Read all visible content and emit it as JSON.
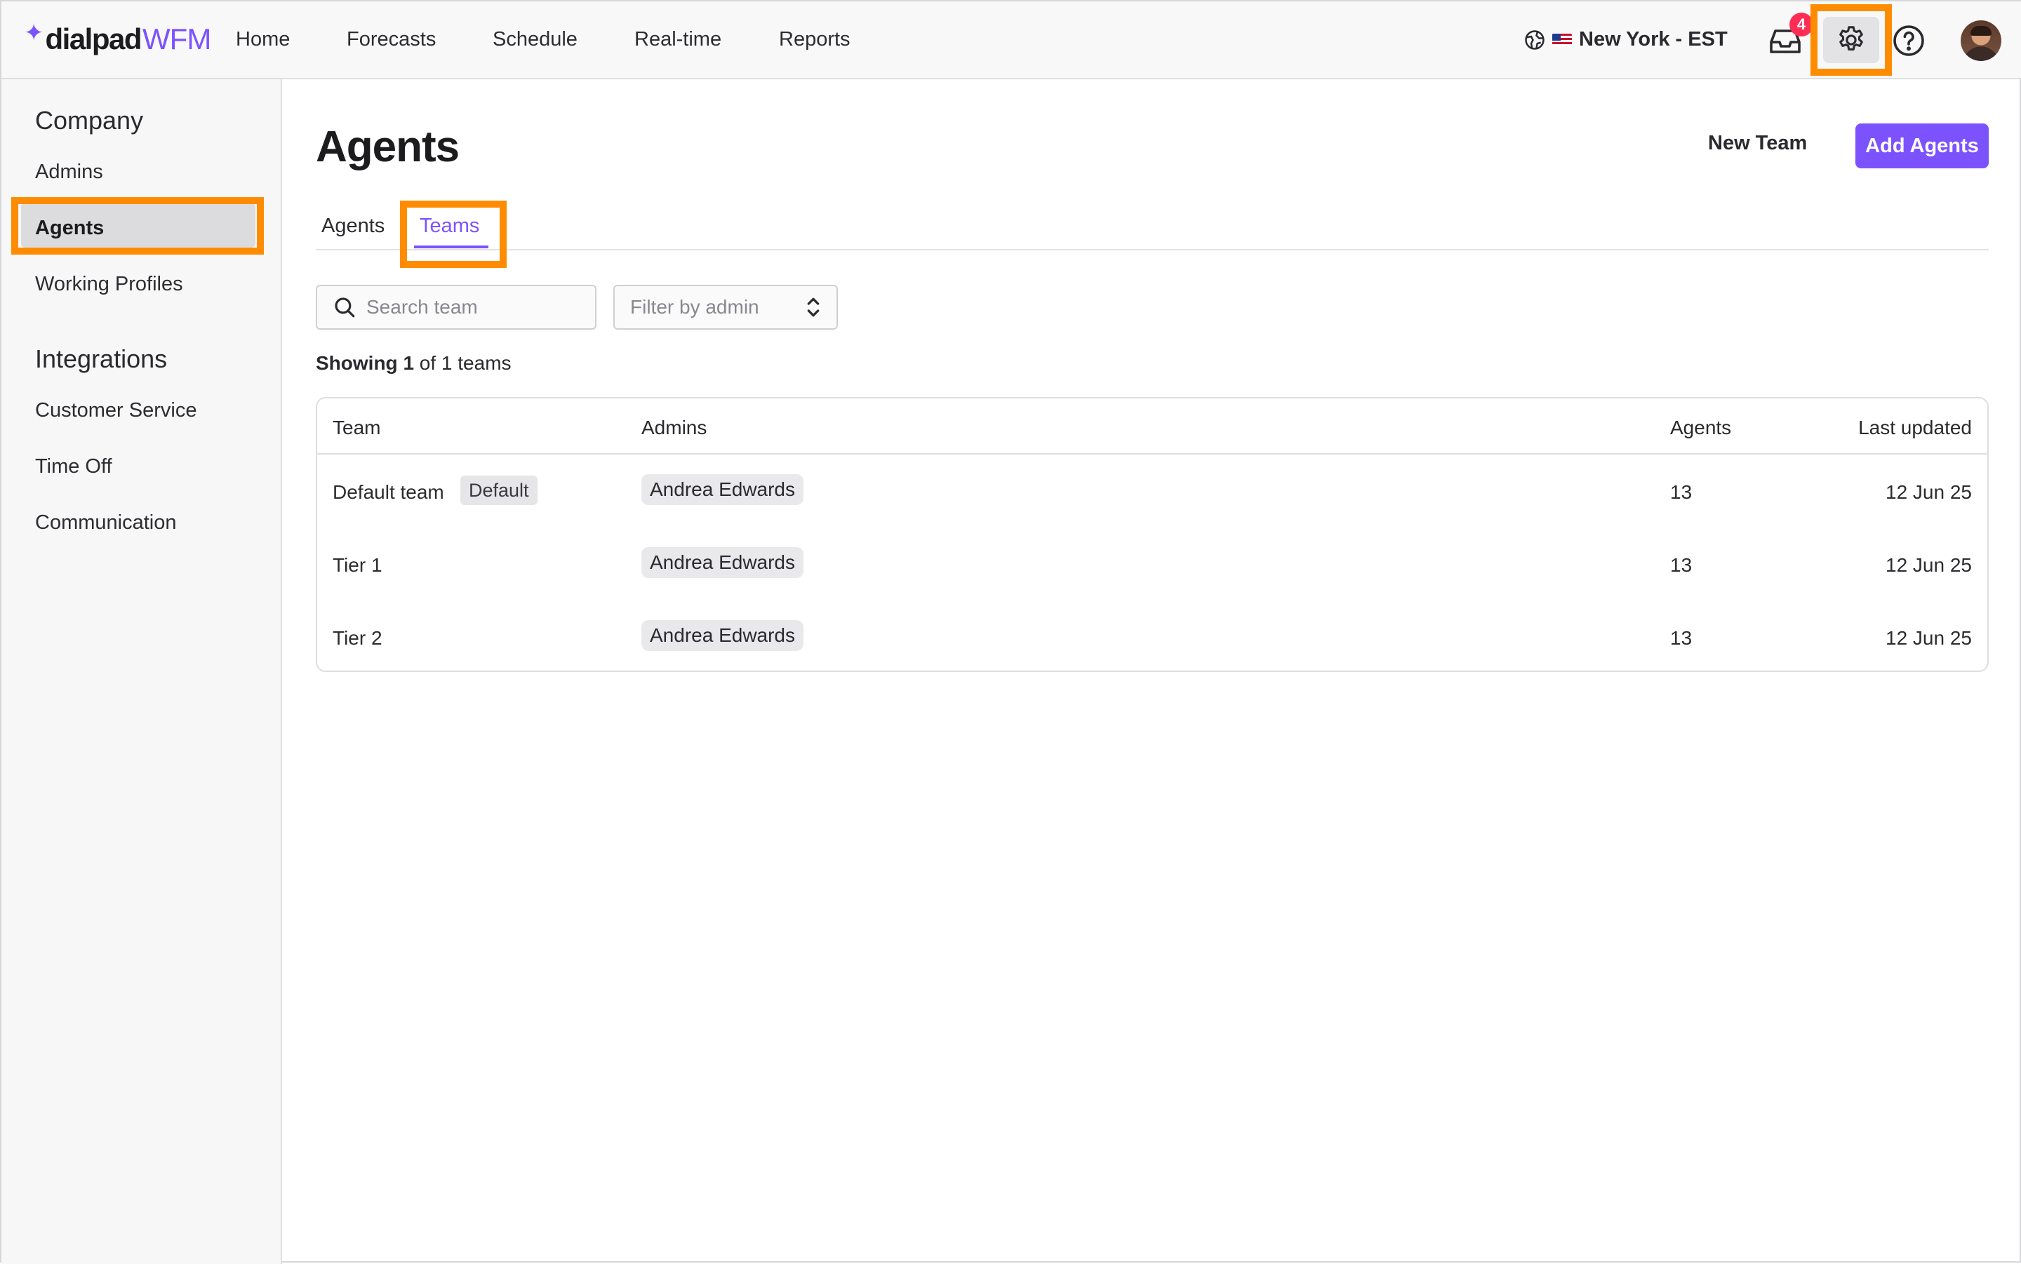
{
  "app": {
    "brand_spark": "✦",
    "brand": "dialpad",
    "product": "WFM",
    "accent": "#7c52ff",
    "highlight": "#ff8c00"
  },
  "nav": {
    "items": [
      "Home",
      "Forecasts",
      "Schedule",
      "Real-time",
      "Reports"
    ],
    "timezone": "New York - EST",
    "inbox_count": "4",
    "icons": [
      "globe-icon",
      "us-flag-icon",
      "inbox-icon",
      "gear-icon",
      "help-icon",
      "avatar"
    ]
  },
  "sidebar": {
    "sections": [
      {
        "heading": "Company",
        "items": [
          "Admins",
          "Agents",
          "Working Profiles"
        ]
      },
      {
        "heading": "Integrations",
        "items": [
          "Customer Service",
          "Time Off",
          "Communication"
        ]
      }
    ],
    "active_item": "Agents"
  },
  "main": {
    "title": "Agents",
    "new_team_label": "New Team",
    "add_agents_label": "Add Agents",
    "tabs": [
      "Agents",
      "Teams"
    ],
    "active_tab": "Teams",
    "search_placeholder": "Search team",
    "filter_placeholder": "Filter by admin",
    "showing": {
      "prefix": "Showing",
      "count": "1",
      "suffix": "of 1 teams"
    },
    "table": {
      "headers": [
        "Team",
        "Admins",
        "Agents",
        "Last updated"
      ],
      "rows": [
        {
          "team": "Default team",
          "tag": "Default",
          "admin": "Andrea Edwards",
          "agents": "13",
          "updated": "12 Jun 25"
        },
        {
          "team": "Tier 1",
          "tag": "",
          "admin": "Andrea Edwards",
          "agents": "13",
          "updated": "12 Jun 25"
        },
        {
          "team": "Tier 2",
          "tag": "",
          "admin": "Andrea Edwards",
          "agents": "13",
          "updated": "12 Jun 25"
        }
      ]
    }
  }
}
